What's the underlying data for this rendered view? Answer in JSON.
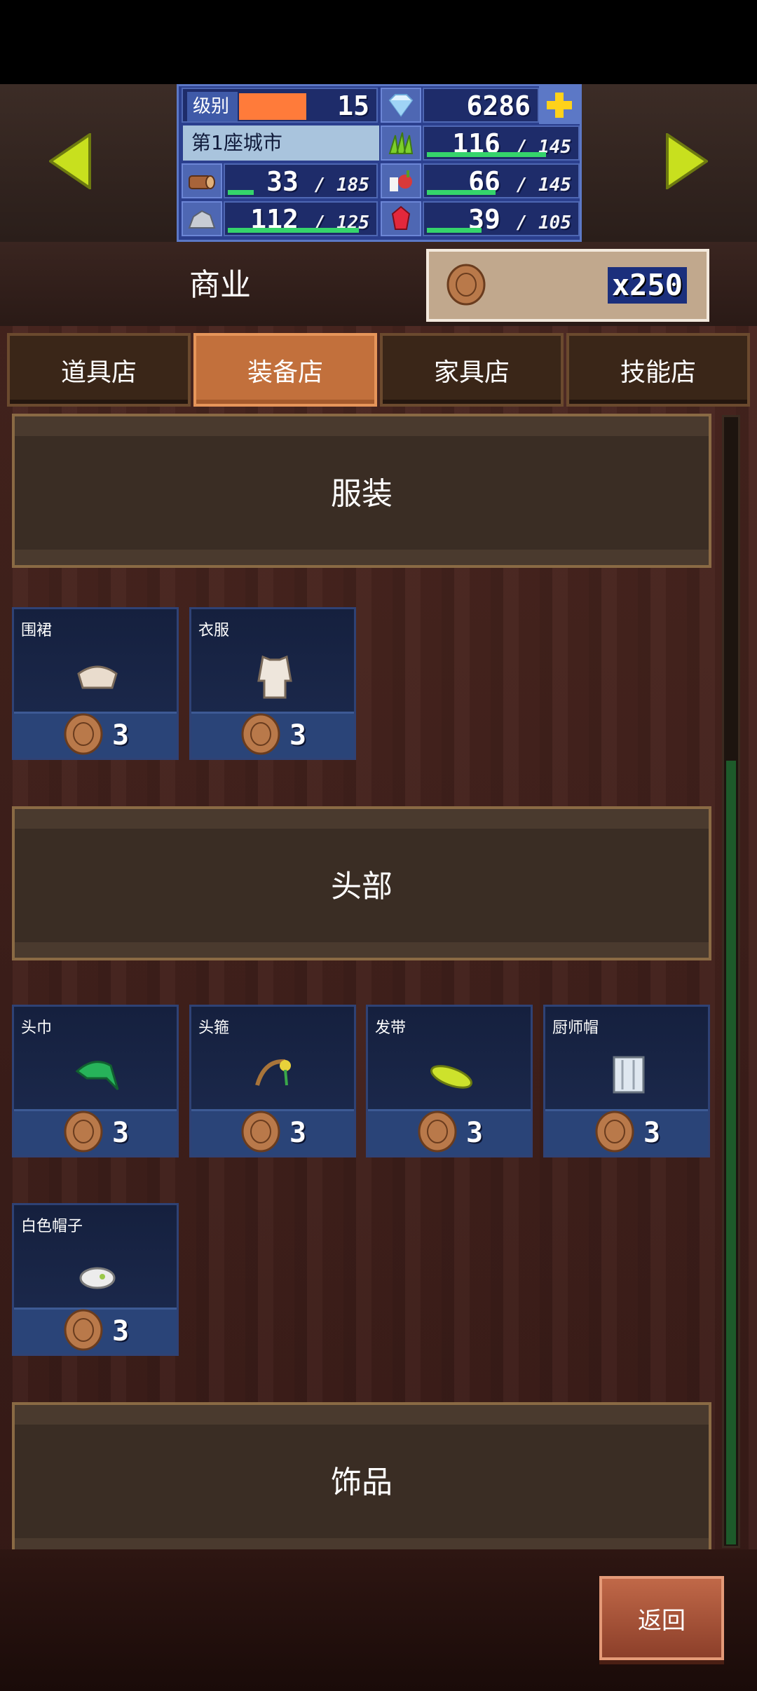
{
  "header": {
    "level_label": "级别",
    "level": "15",
    "gems": "6286",
    "city_name": "第1座城市",
    "wood": {
      "value": "33",
      "max": "185",
      "fraction": 0.18
    },
    "stone": {
      "value": "112",
      "max": "125",
      "fraction": 0.9
    },
    "plants": {
      "value": "116",
      "max": "145",
      "fraction": 0.8
    },
    "food": {
      "value": "66",
      "max": "145",
      "fraction": 0.46
    },
    "ruby": {
      "value": "39",
      "max": "105",
      "fraction": 0.37
    }
  },
  "section": {
    "title": "商业",
    "wood_count": "x250"
  },
  "tabs": [
    {
      "label": "道具店",
      "active": false
    },
    {
      "label": "装备店",
      "active": true
    },
    {
      "label": "家具店",
      "active": false
    },
    {
      "label": "技能店",
      "active": false
    }
  ],
  "categories": {
    "clothing": "服装",
    "head": "头部",
    "accessories": "饰品"
  },
  "items": {
    "clothing": [
      {
        "name": "围裙",
        "price": "3",
        "icon": "apron-icon"
      },
      {
        "name": "衣服",
        "price": "3",
        "icon": "clothes-icon"
      }
    ],
    "head": [
      {
        "name": "头巾",
        "price": "3",
        "icon": "bandana-icon"
      },
      {
        "name": "头箍",
        "price": "3",
        "icon": "headband-icon"
      },
      {
        "name": "发带",
        "price": "3",
        "icon": "hairband-icon"
      },
      {
        "name": "厨师帽",
        "price": "3",
        "icon": "chef-hat-icon"
      },
      {
        "name": "白色帽子",
        "price": "3",
        "icon": "white-hat-icon"
      }
    ]
  },
  "footer": {
    "back_label": "返回"
  },
  "colors": {
    "accent_tab": "#c2703c",
    "stat_panel": "#2b3f8e",
    "progress": "#35d46b",
    "level_bar": "#ff7b3a"
  }
}
